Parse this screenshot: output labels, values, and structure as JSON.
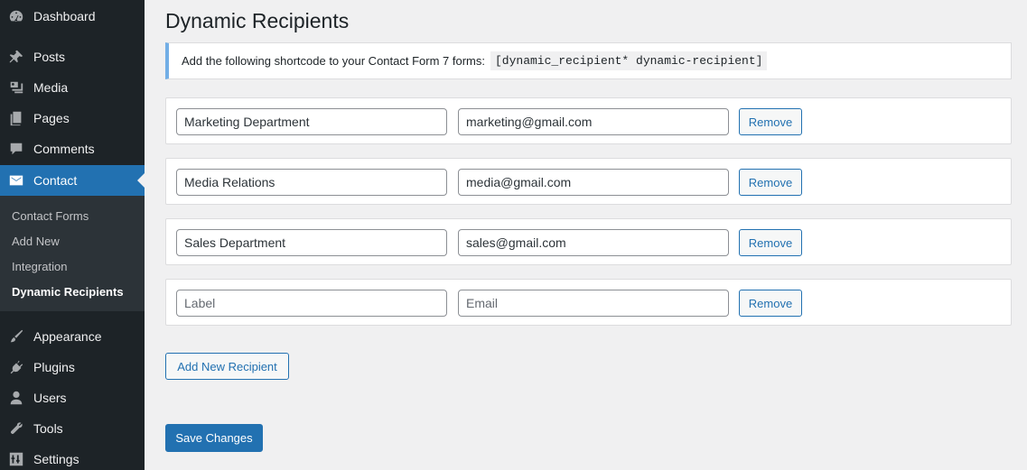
{
  "sidebar": {
    "items": [
      {
        "label": "Dashboard",
        "icon": "dashboard-icon"
      },
      {
        "label": "Posts",
        "icon": "pin-icon"
      },
      {
        "label": "Media",
        "icon": "media-icon"
      },
      {
        "label": "Pages",
        "icon": "pages-icon"
      },
      {
        "label": "Comments",
        "icon": "comment-icon"
      },
      {
        "label": "Contact",
        "icon": "envelope-icon",
        "active": true
      },
      {
        "label": "Appearance",
        "icon": "brush-icon"
      },
      {
        "label": "Plugins",
        "icon": "plugin-icon"
      },
      {
        "label": "Users",
        "icon": "user-icon"
      },
      {
        "label": "Tools",
        "icon": "wrench-icon"
      },
      {
        "label": "Settings",
        "icon": "sliders-icon"
      }
    ],
    "submenu": [
      "Contact Forms",
      "Add New",
      "Integration",
      "Dynamic Recipients"
    ],
    "current_submenu": "Dynamic Recipients"
  },
  "page": {
    "title": "Dynamic Recipients",
    "notice_text": "Add the following shortcode to your Contact Form 7 forms:",
    "shortcode": "[dynamic_recipient* dynamic-recipient]"
  },
  "recipients": [
    {
      "label": "Marketing Department",
      "email": "marketing@gmail.com"
    },
    {
      "label": "Media Relations",
      "email": "media@gmail.com"
    },
    {
      "label": "Sales Department",
      "email": "sales@gmail.com"
    },
    {
      "label": "",
      "email": ""
    }
  ],
  "placeholders": {
    "label": "Label",
    "email": "Email"
  },
  "remove_label": "Remove",
  "add_label": "Add New Recipient",
  "save_label": "Save Changes",
  "colors": {
    "accent": "#2271b1",
    "sidebar_bg": "#1d2327",
    "submenu_bg": "#2c3338",
    "notice_border": "#72aee6"
  }
}
